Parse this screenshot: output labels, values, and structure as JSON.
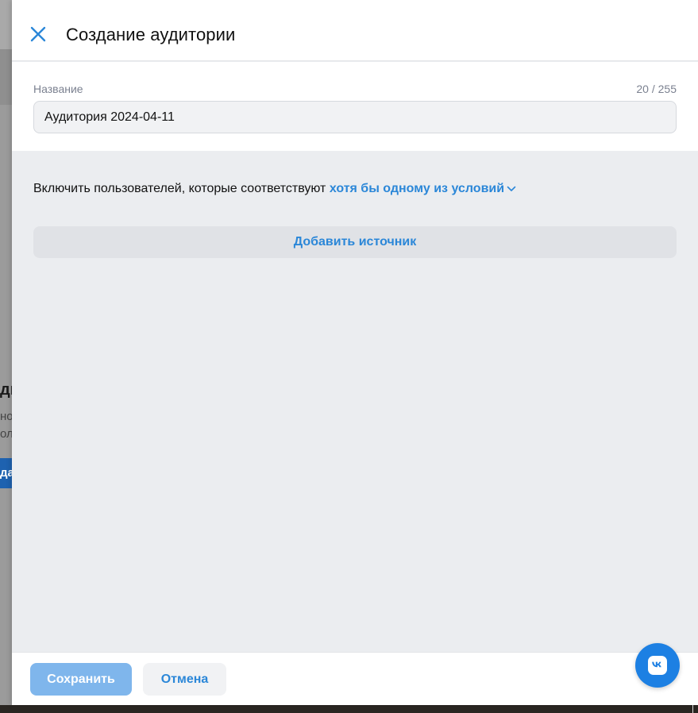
{
  "background": {
    "title_fragment": "ди",
    "line1_fragment": "но",
    "line2_fragment": "ол",
    "button_fragment": "дат"
  },
  "header": {
    "close_icon": "close-icon",
    "title": "Создание аудитории"
  },
  "name_field": {
    "label": "Название",
    "counter": "20 / 255",
    "value": "Аудитория 2024-04-11"
  },
  "conditions": {
    "prefix": "Включить пользователей, которые соответствуют ",
    "selector": "хотя бы одному из условий",
    "selector_icon": "chevron-down-icon"
  },
  "add_source_label": "Добавить источник",
  "footer": {
    "save_label": "Сохранить",
    "cancel_label": "Отмена"
  },
  "fab_icon": "vk-logo-icon",
  "colors": {
    "accent": "#2b87d8",
    "save_disabled": "#7fb6ec",
    "fab": "#1d80e3",
    "panel_bg": "#ebedf0"
  }
}
